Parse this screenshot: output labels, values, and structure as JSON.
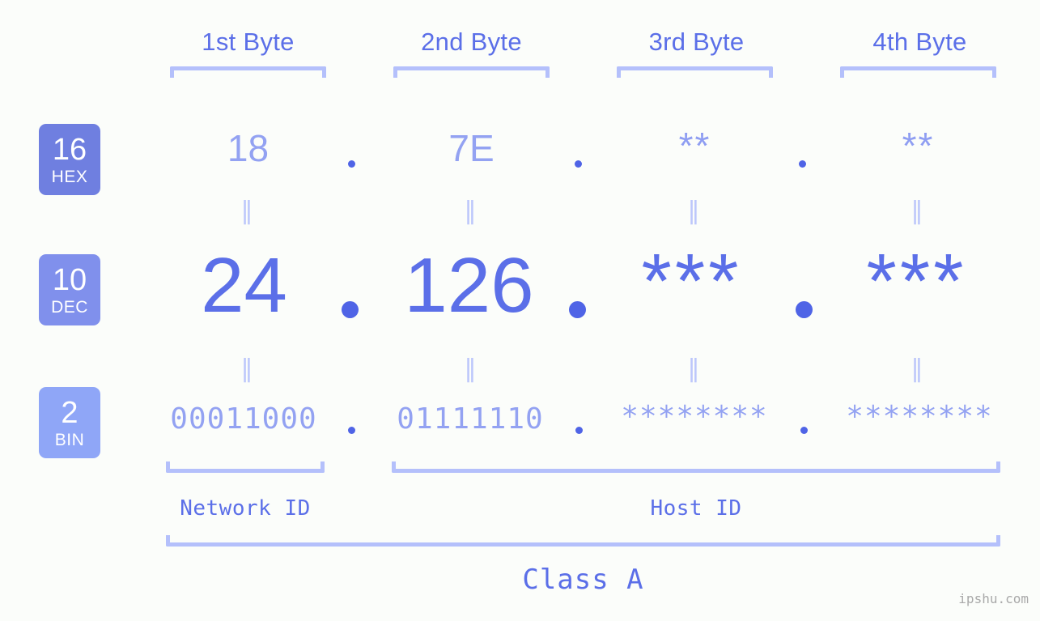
{
  "watermark": "ipshu.com",
  "colors": {
    "background": "#fbfdfa",
    "accent_strong": "#5b6fe8",
    "accent_light": "#93a2f2",
    "bracket": "#b4c0fb",
    "badge_hex": "#6f7fe0",
    "badge_dec": "#8090ec",
    "badge_bin": "#8fa6f7",
    "dot": "#4f64e6",
    "watermark_text": "#a9a9a9"
  },
  "byte_headers": [
    {
      "label": "1st Byte"
    },
    {
      "label": "2nd Byte"
    },
    {
      "label": "3rd Byte"
    },
    {
      "label": "4th Byte"
    }
  ],
  "bases": [
    {
      "number": "16",
      "name": "HEX"
    },
    {
      "number": "10",
      "name": "DEC"
    },
    {
      "number": "2",
      "name": "BIN"
    }
  ],
  "rows": {
    "hex": {
      "values": [
        "18",
        "7E",
        "**",
        "**"
      ],
      "separators": [
        ".",
        ".",
        "."
      ]
    },
    "dec": {
      "values": [
        "24",
        "126",
        "***",
        "***"
      ],
      "separators": [
        ".",
        ".",
        "."
      ]
    },
    "bin": {
      "values": [
        "00011000",
        "01111110",
        "********",
        "********"
      ],
      "separators": [
        ".",
        ".",
        "."
      ]
    }
  },
  "equivalence_marks": [
    "‖",
    "‖",
    "‖",
    "‖"
  ],
  "id_labels": {
    "network": "Network ID",
    "host": "Host ID"
  },
  "class_label": "Class A"
}
